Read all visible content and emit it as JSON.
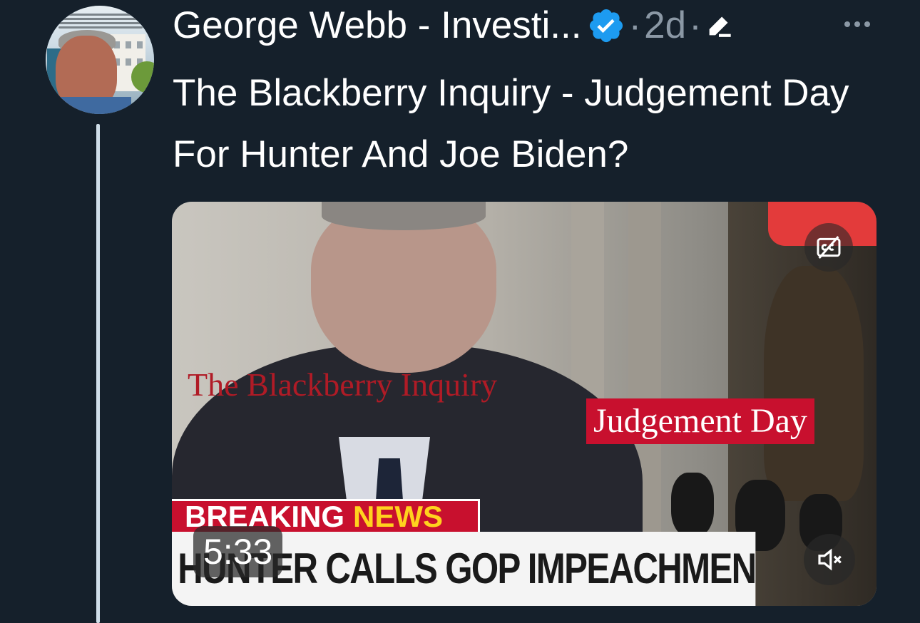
{
  "tweet": {
    "author_name": "George Webb - Investi...",
    "separator": "·",
    "time_ago": "2d",
    "text": "The Blackberry Inquiry - Judgement Day For Hunter And Joe Biden?"
  },
  "media": {
    "overlay_title": "The Blackberry Inquiry",
    "overlay_tag": "Judgement Day",
    "breaking": "BREAKING",
    "news": "NEWS",
    "ticker": "HUNTER CALLS GOP IMPEACHMENT INQUIRY",
    "duration": "5:33"
  },
  "colors": {
    "background": "#15202b",
    "verified": "#1d9bf0",
    "meta": "#8b98a5",
    "breaking_red": "#c8102e",
    "news_yellow": "#ffd21e"
  },
  "icons": {
    "verified": "verified-badge-icon",
    "edited": "edited-pencil-icon",
    "more": "more-dots-icon",
    "captions": "captions-off-icon",
    "mute": "volume-muted-icon"
  }
}
